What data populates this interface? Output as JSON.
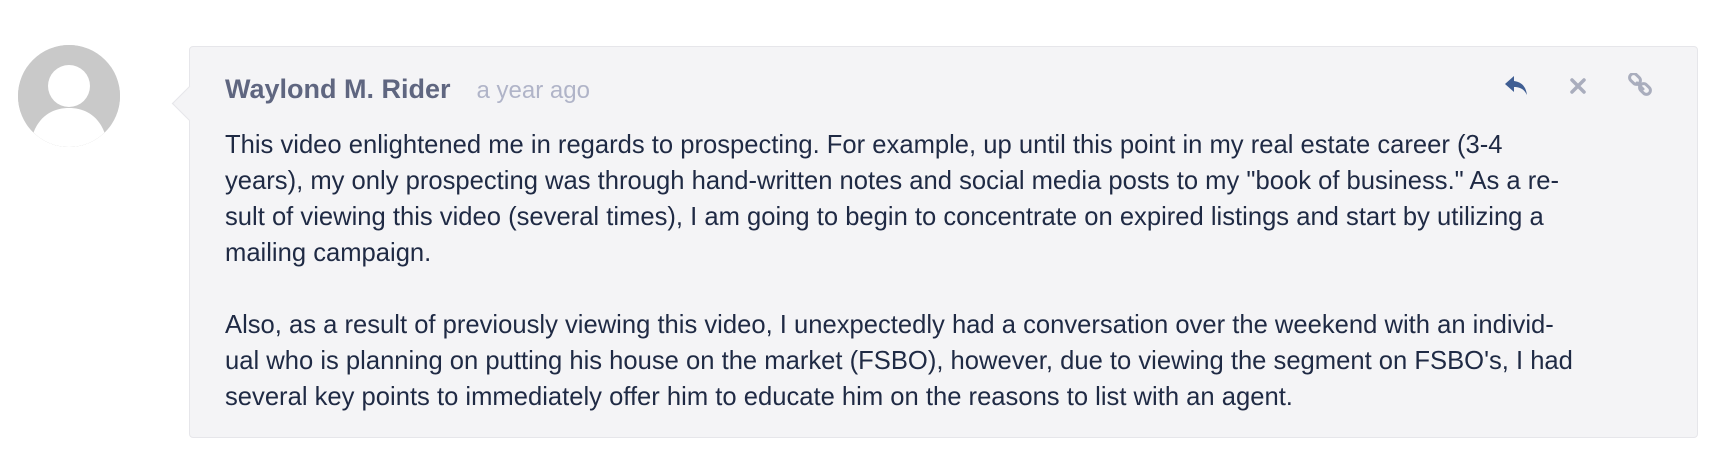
{
  "comment": {
    "author": "Waylond M. Rider",
    "timestamp": "a year ago",
    "icons": {
      "avatar": "user-silhouette",
      "reply": "reply-icon",
      "delete": "close-icon",
      "permalink": "link-icon"
    },
    "colors": {
      "background": "#f4f4f6",
      "author": "#5f6680",
      "timestamp": "#b0b4c8",
      "text": "#1f2a44",
      "reply_icon": "#3f5e93",
      "muted_icon": "#a9adbd"
    },
    "body": {
      "paragraphs": [
        {
          "lines": [
            "This video enlightened me in regards to prospecting.  For example, up until this point in my real estate career (3-4",
            "years), my only prospecting was through hand-written notes and social media posts to my \"book of business.\"  As a re-",
            "sult of viewing this video (several times), I am going to begin to concentrate on expired listings and start by utilizing a",
            "mailing campaign."
          ]
        },
        {
          "lines": [
            "Also, as a result of previously viewing this video, I unexpectedly had a conversation over the weekend with an individ-",
            "ual who is planning on putting his house on the market (FSBO), however, due to viewing the segment on FSBO's, I had",
            "several key points to immediately offer him to educate him on the reasons to list with an agent."
          ]
        }
      ]
    }
  }
}
